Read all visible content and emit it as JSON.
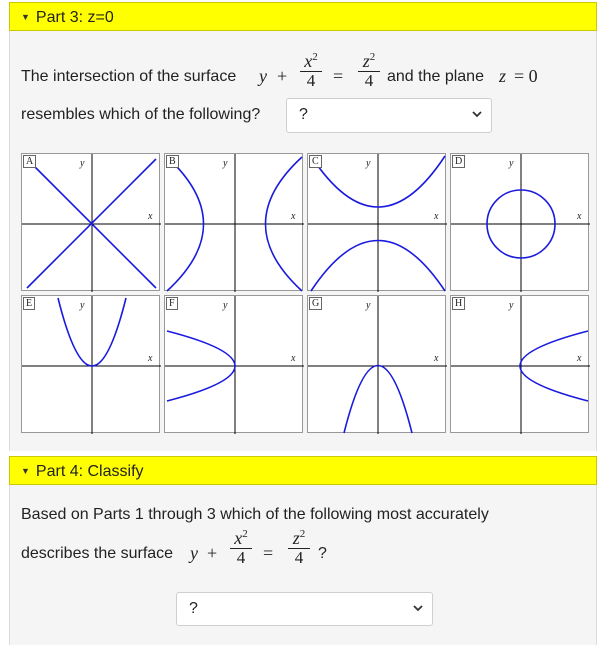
{
  "part3": {
    "header": "Part 3: z=0",
    "text1": "The intersection of the surface",
    "eq_y": "y",
    "plus": "+",
    "x2": "x",
    "z2": "z",
    "sup2": "2",
    "denom": "4",
    "equals": "=",
    "text2": "and the plane",
    "plane_z": "z",
    "plane_eq": "= 0",
    "text3": "resembles which of the following?",
    "select_value": "?"
  },
  "graphs": [
    {
      "tag": "A",
      "xlabel": "x",
      "ylabel": "y"
    },
    {
      "tag": "B",
      "xlabel": "x",
      "ylabel": "y"
    },
    {
      "tag": "C",
      "xlabel": "x",
      "ylabel": "y"
    },
    {
      "tag": "D",
      "xlabel": "x",
      "ylabel": "y"
    },
    {
      "tag": "E",
      "xlabel": "x",
      "ylabel": "y"
    },
    {
      "tag": "F",
      "xlabel": "x",
      "ylabel": "y"
    },
    {
      "tag": "G",
      "xlabel": "x",
      "ylabel": "y"
    },
    {
      "tag": "H",
      "xlabel": "x",
      "ylabel": "y"
    }
  ],
  "part4": {
    "header": "Part 4: Classify",
    "text1": "Based on Parts 1 through 3 which of the following most accurately",
    "text2": "describes the surface",
    "qmark": "?",
    "select_value": "?"
  },
  "colors": {
    "header_bg": "#ffff00",
    "curve": "#1a1adf"
  }
}
